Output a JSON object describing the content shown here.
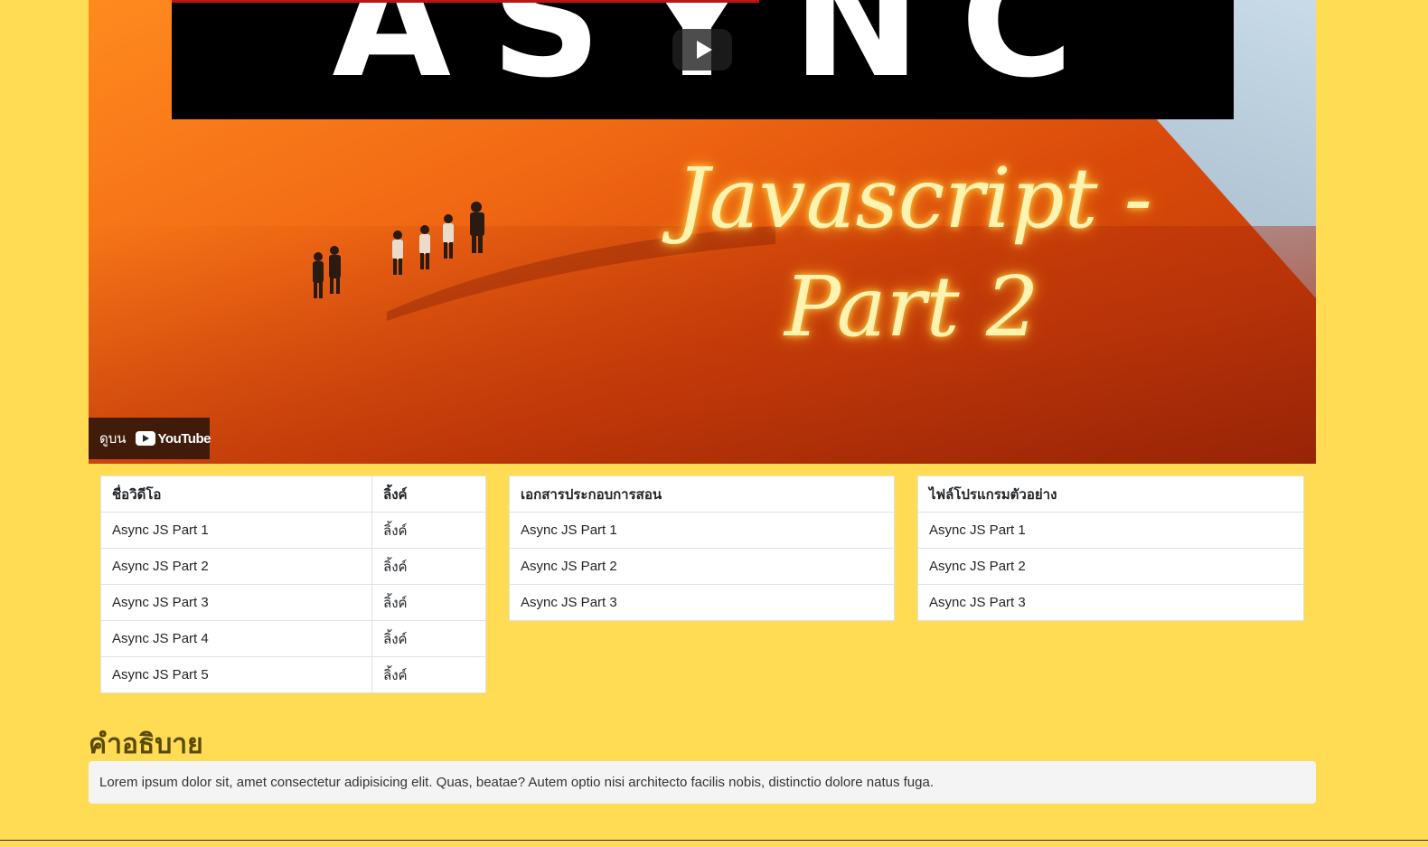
{
  "video": {
    "title_text": "ASYNC",
    "script_line1": "Javascript -",
    "script_line2": "Part 2",
    "watch_on": "ดูบน",
    "youtube": "YouTube"
  },
  "videos_table": {
    "headers": [
      "ชื่อวิดีโอ",
      "ลิ้งค์"
    ],
    "rows": [
      {
        "name": "Async JS Part 1",
        "link": "ลิ้งค์"
      },
      {
        "name": "Async JS Part 2",
        "link": "ลิ้งค์"
      },
      {
        "name": "Async JS Part 3",
        "link": "ลิ้งค์"
      },
      {
        "name": "Async JS Part 4",
        "link": "ลิ้งค์"
      },
      {
        "name": "Async JS Part 5",
        "link": "ลิ้งค์"
      }
    ]
  },
  "docs_table": {
    "header": "เอกสารประกอบการสอน",
    "rows": [
      "Async JS Part 1",
      "Async JS Part 2",
      "Async JS Part 3"
    ]
  },
  "files_table": {
    "header": "ไฟล์โปรแกรมตัวอย่าง",
    "rows": [
      "Async JS Part 1",
      "Async JS Part 2",
      "Async JS Part 3"
    ]
  },
  "description": {
    "heading": "คำอธิบาย",
    "text": "Lorem ipsum dolor sit, amet consectetur adipisicing elit. Quas, beatae? Autem optio nisi architecto facilis nobis, distinctio dolore natus fuga."
  },
  "colors": {
    "page_bg": "#ffdc54",
    "heading": "#5a4a0a"
  }
}
